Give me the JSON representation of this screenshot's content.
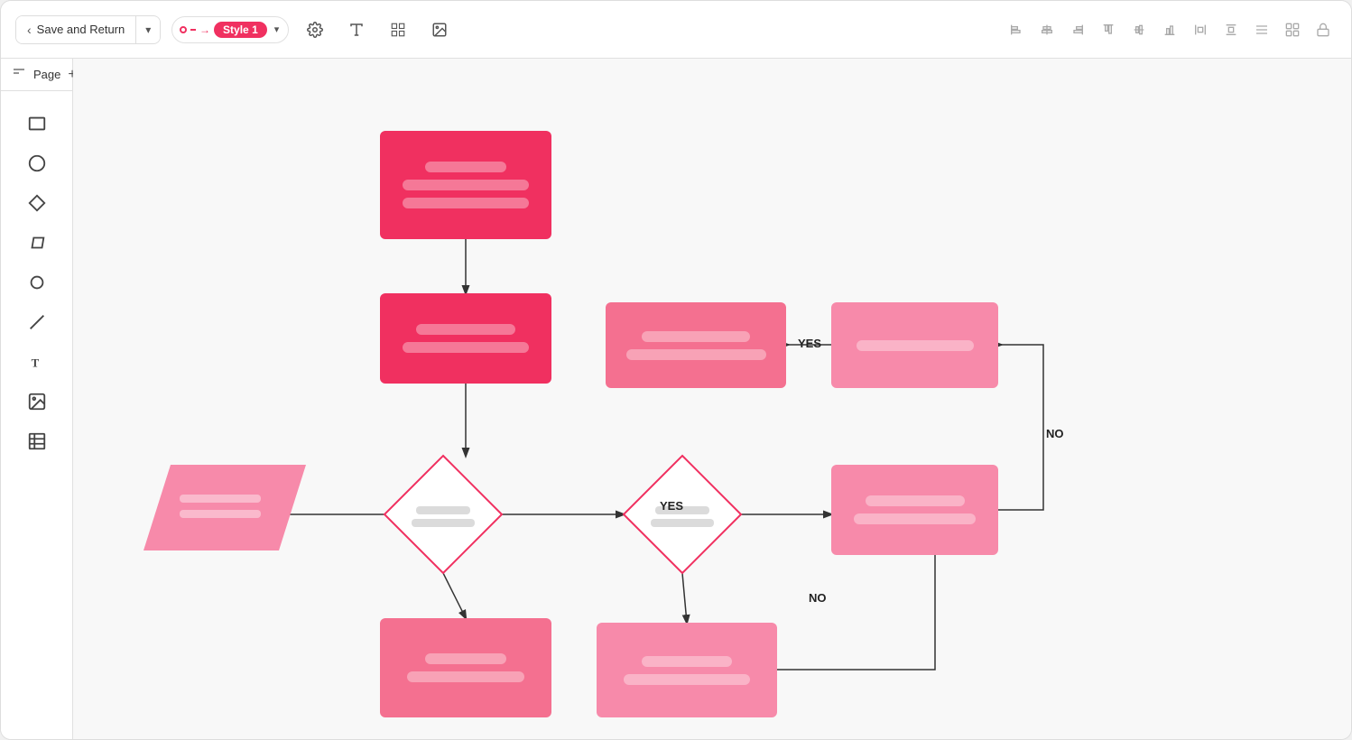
{
  "toolbar": {
    "save_return_label": "Save and Return",
    "back_arrow": "‹",
    "dropdown_arrow": "▾",
    "style_label": "Style 1",
    "icons": {
      "settings": "⚙",
      "text": "A",
      "pattern": "▦",
      "image": "⊡",
      "align_left_top": "⊢",
      "align_center_h": "⊣",
      "align_right_top": "⊤",
      "align_center_v": "⊥",
      "align_right_bottom": "⊦",
      "distribute_h": "⊧",
      "distribute_v": "⊨",
      "more": "≡",
      "group": "⊞",
      "lock": "🔒"
    }
  },
  "sidebar": {
    "pages_label": "Page",
    "add_page_label": "+",
    "shapes": [
      {
        "name": "rectangle",
        "label": "Rectangle"
      },
      {
        "name": "ellipse",
        "label": "Ellipse"
      },
      {
        "name": "diamond",
        "label": "Diamond"
      },
      {
        "name": "parallelogram",
        "label": "Parallelogram"
      },
      {
        "name": "circle",
        "label": "Circle"
      },
      {
        "name": "line",
        "label": "Line"
      },
      {
        "name": "text",
        "label": "Text"
      },
      {
        "name": "image",
        "label": "Image"
      },
      {
        "name": "table",
        "label": "Table"
      }
    ]
  },
  "canvas": {
    "labels": {
      "yes1": "YES",
      "yes2": "YES",
      "no1": "NO",
      "no2": "NO"
    }
  }
}
